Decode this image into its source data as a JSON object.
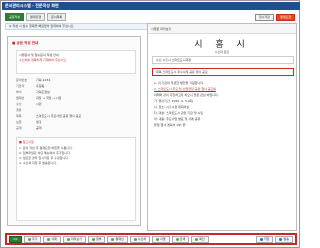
{
  "app": {
    "title": "문서관리시스템 - 전문작성 화면"
  },
  "tabs": [
    {
      "label": "공문작성"
    },
    {
      "label": "결재진행"
    },
    {
      "label": "문서목록"
    }
  ],
  "top_buttons": {
    "temp_save": "임시저장",
    "submit": "결재요청"
  },
  "note_bar": {
    "text": "※ 작성 시 필수 항목을 빠짐없이 입력하여 주십시오."
  },
  "left": {
    "heading": "■ 공문 작성 안내",
    "info_line1": "시행문서 및 접수문서 작성 안내",
    "info_line2": "수신처를 정확하게 기재하여 주십시오.",
    "fields": [
      {
        "k": "문서번호",
        "v": "기획-1234"
      },
      {
        "k": "기안자",
        "v": "홍길동"
      },
      {
        "k": "부서",
        "v": "기획조정실"
      },
      {
        "k": "결재선",
        "v": "과장 → 국장 → 시장"
      },
      {
        "k": "수신",
        "v": "시민"
      },
      {
        "k": "경유",
        "v": ""
      },
      {
        "k": "제목",
        "v": "스마트도시 주요사업 공유 행사 공모"
      },
      {
        "k": "보존",
        "v": "영구"
      },
      {
        "k": "공개",
        "v": "공개"
      }
    ],
    "list_title": "■ 참고사항",
    "list_items": [
      "1. 문서 작성 후 결재요청 버튼을 누릅니다.",
      "2. 첨부파일은 하단 메뉴에서 추가합니다.",
      "3. 필요한 경우 임시저장 후 수정합니다.",
      "4. 수신처 지정 후 발송합니다."
    ]
  },
  "doc": {
    "header": "시행문 미리보기",
    "title": "시 흥 시",
    "subtitle": "수신자 참조",
    "receiver": "수신  시흥시 스마트도시과장",
    "subject": "제목  스마트도시 우수사례 공유 행사 공모",
    "body": [
      "1. 귀 기관의 무궁한 발전을 기원합니다.",
      "2. 스마트도시 주요 및 산업현장 공유 행사 공모를",
      "   아래와 같이 추진하고자 하오니 많은 관심 바랍니다.",
      "가. 행사기간: 2025. 6. 5.(목)",
      "나. 장소: 시흥시청 대회의실",
      "다. 대상: 스마트도시 관련 기관 및 시민",
      "라. 내용: 주요사업 발표 및 사례 공유",
      "붙임  행사 계획서 1부.  끝."
    ]
  },
  "bottom": {
    "page": "1/1",
    "buttons": [
      "추가",
      "삭제",
      "미리보기",
      "첨부",
      "결재선",
      "수신처",
      "서명",
      "인쇄",
      "확인"
    ],
    "right": [
      "저장",
      "발송"
    ]
  },
  "colors": {
    "brand": "#1f4f93",
    "accent": "#c62828",
    "green": "#2e7d32"
  }
}
